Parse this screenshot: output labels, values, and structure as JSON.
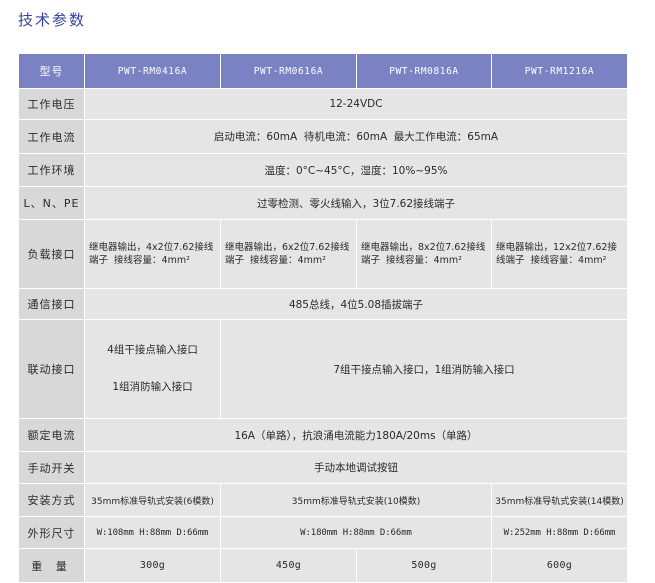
{
  "page": {
    "title": "技术参数"
  },
  "colors": {
    "header_bg": "#7b82c4",
    "label_bg": "#d8d8d8",
    "cell_bg": "#e5e5e5",
    "title": "#34459b",
    "text": "#2a2a2a",
    "grid": "#ffffff"
  },
  "table": {
    "header": {
      "label": "型号",
      "models": [
        "PWT-RM0416A",
        "PWT-RM0616A",
        "PWT-RM0816A",
        "PWT-RM1216A"
      ]
    },
    "rows": [
      {
        "label": "工作电压",
        "cells": [
          "12-24VDC"
        ]
      },
      {
        "label": "工作电流",
        "cells": [
          "启动电流：60mA  待机电流：60mA  最大工作电流：65mA"
        ]
      },
      {
        "label": "工作环境",
        "cells": [
          "温度：0°C~45°C，湿度：10%~95%"
        ]
      },
      {
        "label": "L、N、PE",
        "cells": [
          "过零检测、零火线输入，3位7.62接线端子"
        ]
      },
      {
        "label": "负载接口",
        "cells": [
          "继电器输出，4x2位7.62接线端子  接线容量：4mm²",
          "继电器输出，6x2位7.62接线端子  接线容量：4mm²",
          "继电器输出，8x2位7.62接线端子  接线容量：4mm²",
          "继电器输出，12x2位7.62接线端子  接线容量：4mm²"
        ]
      },
      {
        "label": "通信接口",
        "cells": [
          "485总线，4位5.08插拔端子"
        ]
      },
      {
        "label": "联动接口",
        "first_cell": [
          "4组干接点输入接口",
          "1组消防输入接口"
        ],
        "cells": [
          "7组干接点输入接口，1组消防输入接口"
        ]
      },
      {
        "label": "额定电流",
        "cells": [
          "16A（单路），抗浪涌电流能力180A/20ms（单路）"
        ]
      },
      {
        "label": "手动开关",
        "cells": [
          "手动本地调试按钮"
        ]
      },
      {
        "label": "安装方式",
        "cells": [
          "35mm标准导轨式安装(6模数)",
          "35mm标准导轨式安装(10模数)",
          "35mm标准导轨式安装(14模数)"
        ]
      },
      {
        "label": "外形尺寸",
        "cells": [
          "W:108mm H:88mm D:66mm",
          "W:180mm H:88mm D:66mm",
          "W:252mm H:88mm D:66mm"
        ]
      },
      {
        "label": "重 量",
        "cells": [
          "300g",
          "450g",
          "500g",
          "600g"
        ]
      }
    ]
  }
}
